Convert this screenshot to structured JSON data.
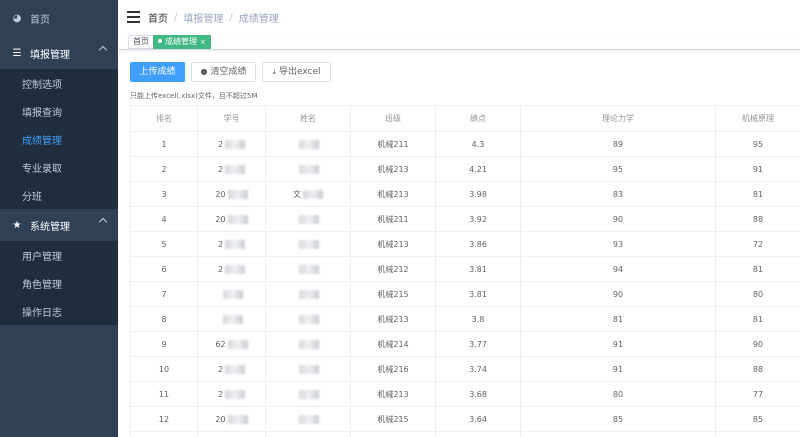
{
  "sidebar": {
    "home": "首页",
    "groups": [
      {
        "label": "填报管理",
        "items": [
          "控制选项",
          "填报查询",
          "成绩管理",
          "专业录取",
          "分班"
        ]
      },
      {
        "label": "系统管理",
        "items": [
          "用户管理",
          "角色管理",
          "操作日志"
        ]
      }
    ],
    "active_item": "成绩管理"
  },
  "breadcrumb": [
    "首页",
    "填报管理",
    "成绩管理"
  ],
  "tags": {
    "home": "首页",
    "active": "成绩管理",
    "close_glyph": "×"
  },
  "toolbar": {
    "upload": "上传成绩",
    "clear": "清空成绩",
    "export": "导出excel"
  },
  "tip": "只能上传excel(.xlsx)文件，且不超过5M",
  "table": {
    "headers": [
      "排名",
      "学号",
      "姓名",
      "班级",
      "绩点",
      "理论力学",
      "机械原理"
    ],
    "rows": [
      {
        "rank": "1",
        "id": "2",
        "name": "",
        "class": "机械211",
        "gpa": "4.3",
        "mech": "89",
        "mpr": "95"
      },
      {
        "rank": "2",
        "id": "2",
        "name": "",
        "class": "机械213",
        "gpa": "4.21",
        "mech": "95",
        "mpr": "91"
      },
      {
        "rank": "3",
        "id": "20",
        "name": "文",
        "class": "机械213",
        "gpa": "3.98",
        "mech": "83",
        "mpr": "81"
      },
      {
        "rank": "4",
        "id": "20",
        "name": "",
        "class": "机械211",
        "gpa": "3.92",
        "mech": "90",
        "mpr": "88"
      },
      {
        "rank": "5",
        "id": "2",
        "name": "",
        "class": "机械213",
        "gpa": "3.86",
        "mech": "93",
        "mpr": "72"
      },
      {
        "rank": "6",
        "id": "2",
        "name": "",
        "class": "机械212",
        "gpa": "3.81",
        "mech": "94",
        "mpr": "81"
      },
      {
        "rank": "7",
        "id": "",
        "name": "",
        "class": "机械215",
        "gpa": "3.81",
        "mech": "90",
        "mpr": "80"
      },
      {
        "rank": "8",
        "id": "",
        "name": "",
        "class": "机械213",
        "gpa": "3.8",
        "mech": "81",
        "mpr": "81"
      },
      {
        "rank": "9",
        "id": "62",
        "name": "",
        "class": "机械214",
        "gpa": "3.77",
        "mech": "91",
        "mpr": "90"
      },
      {
        "rank": "10",
        "id": "2",
        "name": "",
        "class": "机械216",
        "gpa": "3.74",
        "mech": "91",
        "mpr": "88"
      },
      {
        "rank": "11",
        "id": "2",
        "name": "",
        "class": "机械213",
        "gpa": "3.68",
        "mech": "80",
        "mpr": "77"
      },
      {
        "rank": "12",
        "id": "20",
        "name": "",
        "class": "机械215",
        "gpa": "3.64",
        "mech": "85",
        "mpr": "85"
      },
      {
        "rank": "",
        "id": "",
        "name": "",
        "class": "",
        "gpa": "",
        "mech": "",
        "mpr": ""
      }
    ]
  },
  "colors": {
    "sidebar_bg": "#304156",
    "submenu_bg": "#1f2d3d",
    "primary": "#409eff",
    "tag_active": "#42b983"
  },
  "icons": {
    "home": "dashboard-icon",
    "fill": "list-icon",
    "system": "star-icon",
    "clear": "user-icon",
    "export": "download-icon"
  }
}
